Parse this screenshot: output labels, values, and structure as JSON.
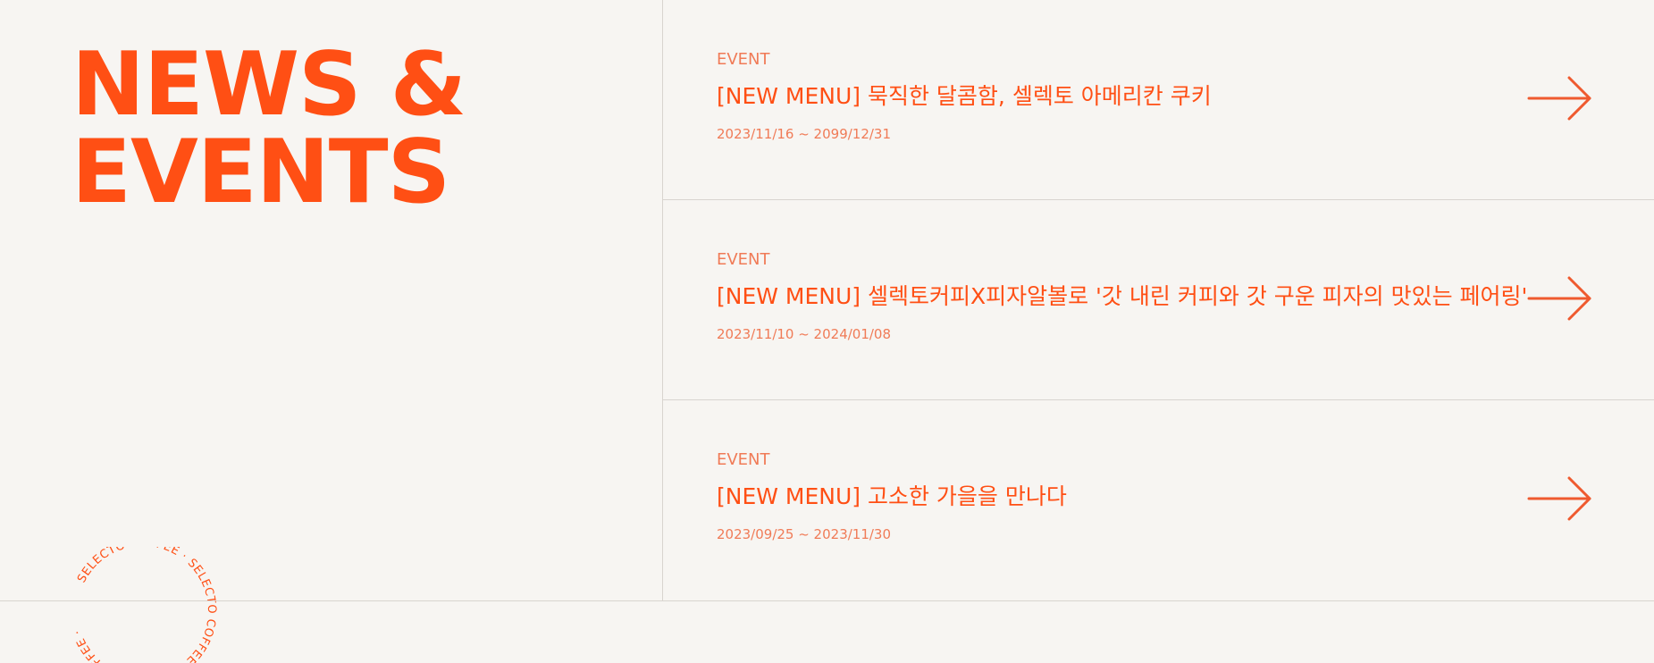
{
  "section": {
    "title_line1": "NEWS &",
    "title_line2": "EVENTS"
  },
  "badge": {
    "circular_text": "SELECTO COFFEE · SELECTO COFFEE · SELECTO COFFEE · "
  },
  "events": [
    {
      "category": "EVENT",
      "title": "[NEW MENU] 묵직한 달콤함, 셀렉토 아메리칸 쿠키",
      "dates": "2023/11/16 ~ 2099/12/31",
      "arrow_icon": "arrow-right-icon"
    },
    {
      "category": "EVENT",
      "title": "[NEW MENU] 셀렉토커피X피자알볼로 '갓 내린 커피와 갓 구운 피자의 맛있는 페어링'",
      "dates": "2023/11/10 ~ 2024/01/08",
      "arrow_icon": "arrow-right-icon"
    },
    {
      "category": "EVENT",
      "title": "[NEW MENU] 고소한 가을을 만나다",
      "dates": "2023/09/25 ~ 2023/11/30",
      "arrow_icon": "arrow-right-icon"
    }
  ],
  "colors": {
    "accent": "#ff4f14",
    "accent_soft": "#f07b57",
    "background": "#f7f5f2",
    "line": "#d8d4cf"
  }
}
